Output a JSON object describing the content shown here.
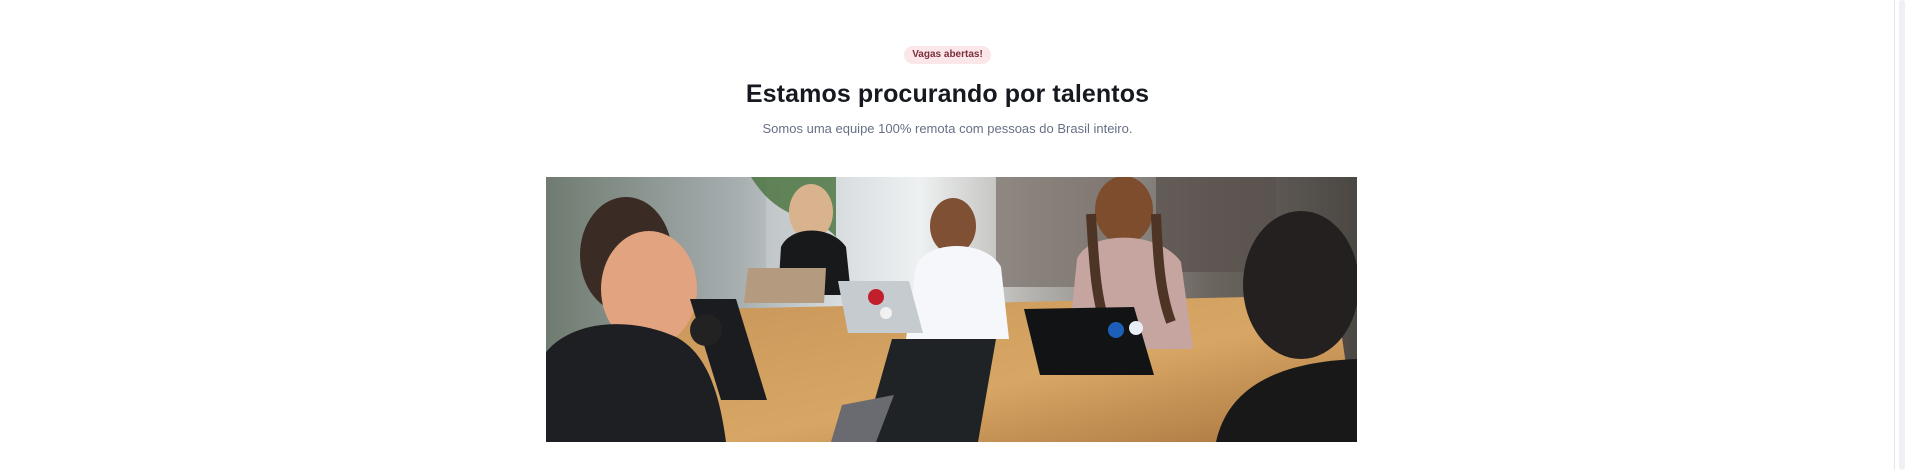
{
  "header": {
    "badge": "Vagas abertas!",
    "title": "Estamos procurando por talentos",
    "subtitle": "Somos uma equipe 100% remota com pessoas do Brasil inteiro."
  },
  "photo": {
    "alt": "Equipe trabalhando em volta de uma mesa com notebooks"
  },
  "colors": {
    "badge_bg": "#fbe7ea",
    "badge_text": "#7a2f3b",
    "title": "#16191f",
    "subtitle": "#667085"
  }
}
